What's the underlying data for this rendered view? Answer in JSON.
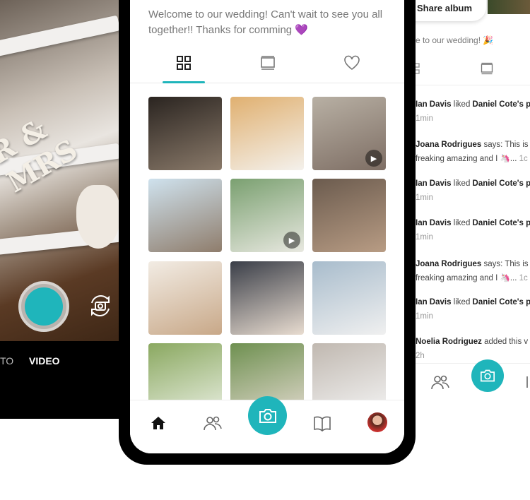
{
  "camera": {
    "banner_text": "R & MRS",
    "modes": [
      "TO",
      "VIDEO"
    ],
    "accent": "#1fb5bb"
  },
  "album": {
    "welcome": "Welcome to our wedding! Can't wait to see you all together!! Thanks for comming 💜",
    "tabs": [
      "grid-icon",
      "slideshow-icon",
      "heart-icon"
    ],
    "active_tab": 0,
    "photos": [
      {
        "colors": [
          "#2a2420",
          "#8a7a6a"
        ],
        "video": false
      },
      {
        "colors": [
          "#e0b070",
          "#f4f1ec"
        ],
        "video": false
      },
      {
        "colors": [
          "#b8b0a4",
          "#7e6e64"
        ],
        "video": true
      },
      {
        "colors": [
          "#cfe2ee",
          "#8f7d6c"
        ],
        "video": false
      },
      {
        "colors": [
          "#7aa070",
          "#e8e8e0"
        ],
        "video": true
      },
      {
        "colors": [
          "#6b5b4e",
          "#b89c84"
        ],
        "video": false
      },
      {
        "colors": [
          "#f2ece4",
          "#c8a888"
        ],
        "video": false
      },
      {
        "colors": [
          "#3a3e48",
          "#e8dcd0"
        ],
        "video": false
      },
      {
        "colors": [
          "#a8bccc",
          "#f0f0f0"
        ],
        "video": false
      },
      {
        "colors": [
          "#8aa860",
          "#e8eee0"
        ],
        "video": false
      },
      {
        "colors": [
          "#6e9050",
          "#e0d8cc"
        ],
        "video": false
      },
      {
        "colors": [
          "#c0b8b0",
          "#f4f4f4"
        ],
        "video": false
      }
    ],
    "nav": [
      "home-icon",
      "people-icon",
      "camera-icon",
      "book-icon",
      "avatar"
    ]
  },
  "activity": {
    "share_label": "Share album",
    "welcome": "e to our wedding! 🎉",
    "items": [
      {
        "name": "Ian Davis",
        "verb": " liked ",
        "target": "Daniel Cote's p",
        "time": "1min"
      },
      {
        "name": "Joana Rodrigues",
        "verb": " says: This is",
        "line2": "freaking amazing and I 🦄...",
        "time": "1c"
      },
      {
        "name": "Ian Davis",
        "verb": " liked ",
        "target": "Daniel Cote's p",
        "time": "1min"
      },
      {
        "name": "Ian Davis",
        "verb": " liked ",
        "target": "Daniel Cote's p",
        "time": "1min"
      },
      {
        "name": "Joana Rodrigues",
        "verb": " says: This is",
        "line2": "freaking amazing and I 🦄...",
        "time": "1c"
      },
      {
        "name": "Ian Davis",
        "verb": " liked ",
        "target": "Daniel Cote's p",
        "time": "1min"
      },
      {
        "name": "Noelia Rodriguez",
        "verb": " added this v",
        "time": "2h"
      }
    ]
  }
}
